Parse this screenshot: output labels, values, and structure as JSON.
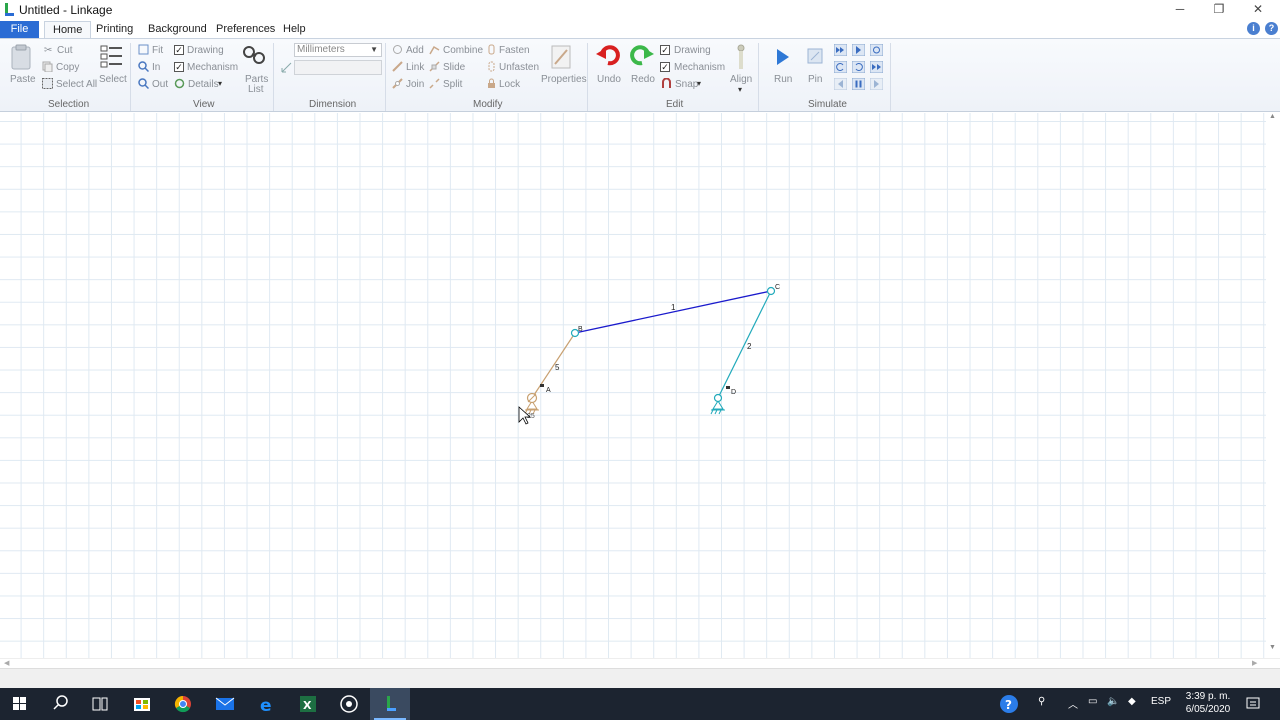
{
  "window": {
    "title": "Untitled - Linkage",
    "minimize": "─",
    "restore": "❐",
    "close": "✕"
  },
  "tabs": [
    "File",
    "Home",
    "Printing",
    "Background",
    "Preferences",
    "Help"
  ],
  "ribbon": {
    "selection": {
      "label": "Selection",
      "paste": "Paste",
      "cut": "Cut",
      "copy": "Copy",
      "select_all": "Select All",
      "select": "Select"
    },
    "view": {
      "label": "View",
      "fit": "Fit",
      "in": "In",
      "out": "Out",
      "drawing": "Drawing",
      "mechanism": "Mechanism",
      "details": "Details",
      "parts_list_1": "Parts",
      "parts_list_2": "List"
    },
    "dimension": {
      "label": "Dimension",
      "units": "Millimeters"
    },
    "modify": {
      "label": "Modify",
      "add": "Add",
      "link": "Link",
      "join": "Join",
      "combine": "Combine",
      "slide": "Slide",
      "split": "Split",
      "fasten": "Fasten",
      "unfasten": "Unfasten",
      "lock": "Lock",
      "properties": "Properties"
    },
    "edit": {
      "label": "Edit",
      "undo": "Undo",
      "redo": "Redo",
      "drawing": "Drawing",
      "mechanism": "Mechanism",
      "snap": "Snap",
      "align": "Align"
    },
    "simulate": {
      "label": "Simulate",
      "run": "Run",
      "pin": "Pin"
    }
  },
  "mechanism": {
    "links": [
      {
        "name": "1",
        "color": "#1a1acc"
      },
      {
        "name": "2",
        "color": "#22aabb"
      },
      {
        "name": "5",
        "color": "#c8a070"
      }
    ],
    "joints": [
      "A",
      "B",
      "C",
      "D"
    ],
    "input_speed": "25"
  },
  "taskbar": {
    "language": "ESP",
    "time": "3:39 p. m.",
    "date": "6/05/2020"
  }
}
